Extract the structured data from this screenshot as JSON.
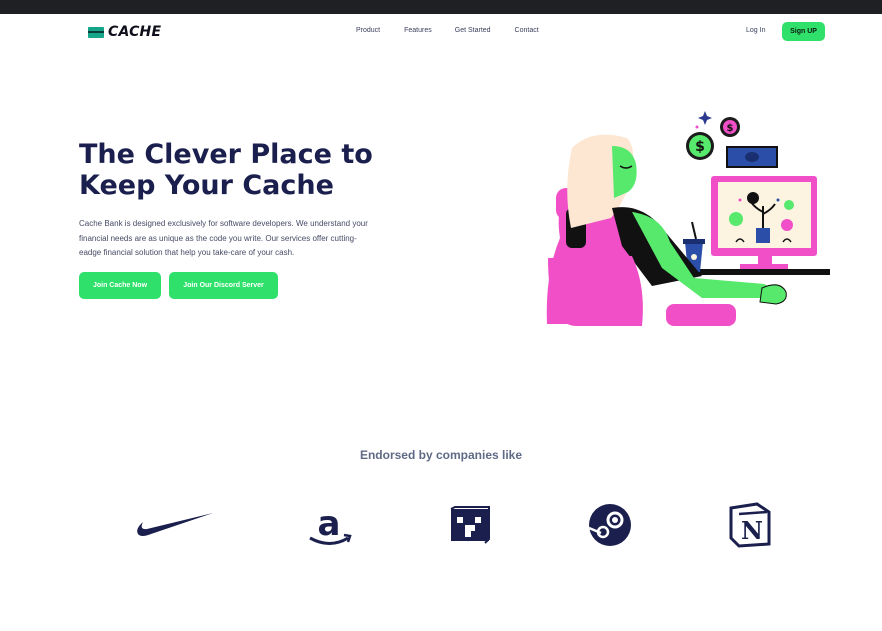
{
  "nav": {
    "logo": "CACHE",
    "links": [
      "Product",
      "Features",
      "Get Started",
      "Contact"
    ],
    "login": "Log In",
    "signup": "Sign UP"
  },
  "hero": {
    "title": "The Clever Place to Keep Your Cache",
    "description": "Cache Bank is designed exclusively for software developers. We understand your financial needs are as unique as the code you write. Our services offer cutting-eadge financial solution that help you take-care of your cash.",
    "primary_button": "Join Cache Now",
    "secondary_button": "Join Our Discord Server"
  },
  "endorsements": {
    "heading": "Endorsed by companies like",
    "logos": [
      "nike-logo",
      "amazon-logo",
      "minecraft-logo",
      "steam-logo",
      "notion-logo"
    ]
  },
  "colors": {
    "accent": "#2fe06b",
    "navy": "#1b1f4d",
    "pink": "#f04fc8",
    "skin": "#57e96c"
  }
}
